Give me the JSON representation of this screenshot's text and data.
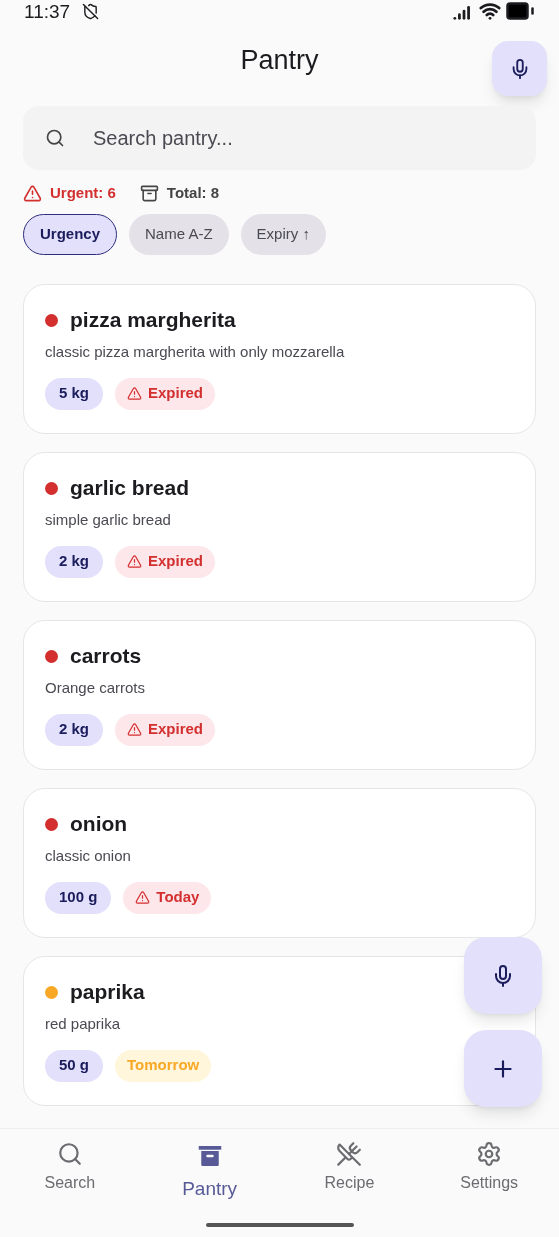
{
  "status_bar": {
    "time": "11:37"
  },
  "title": "Pantry",
  "search": {
    "placeholder": "Search pantry..."
  },
  "stats": {
    "urgent": "Urgent: 6",
    "total": "Total: 8"
  },
  "sort_chips": [
    {
      "label": "Urgency",
      "selected": true
    },
    {
      "label": "Name A-Z",
      "selected": false
    },
    {
      "label": "Expiry ↑",
      "selected": false
    }
  ],
  "items": [
    {
      "name": "pizza margherita",
      "description": "classic pizza margherita with only mozzarella",
      "quantity": "5 kg",
      "expiry": "Expired",
      "kind": "urgent",
      "color": "#d32f2f"
    },
    {
      "name": "garlic bread",
      "description": "simple garlic bread",
      "quantity": "2 kg",
      "expiry": "Expired",
      "kind": "urgent",
      "color": "#d32f2f"
    },
    {
      "name": "carrots",
      "description": "Orange carrots",
      "quantity": "2 kg",
      "expiry": "Expired",
      "kind": "urgent",
      "color": "#d32f2f"
    },
    {
      "name": "onion",
      "description": "classic onion",
      "quantity": "100 g",
      "expiry": "Today",
      "kind": "urgent",
      "color": "#d32f2f"
    },
    {
      "name": "paprika",
      "description": "red paprika",
      "quantity": "50 g",
      "expiry": "Tomorrow",
      "kind": "soon",
      "color": "#f9a825"
    }
  ],
  "nav": [
    {
      "label": "Search",
      "selected": false
    },
    {
      "label": "Pantry",
      "selected": true
    },
    {
      "label": "Recipe",
      "selected": false
    },
    {
      "label": "Settings",
      "selected": false
    }
  ]
}
